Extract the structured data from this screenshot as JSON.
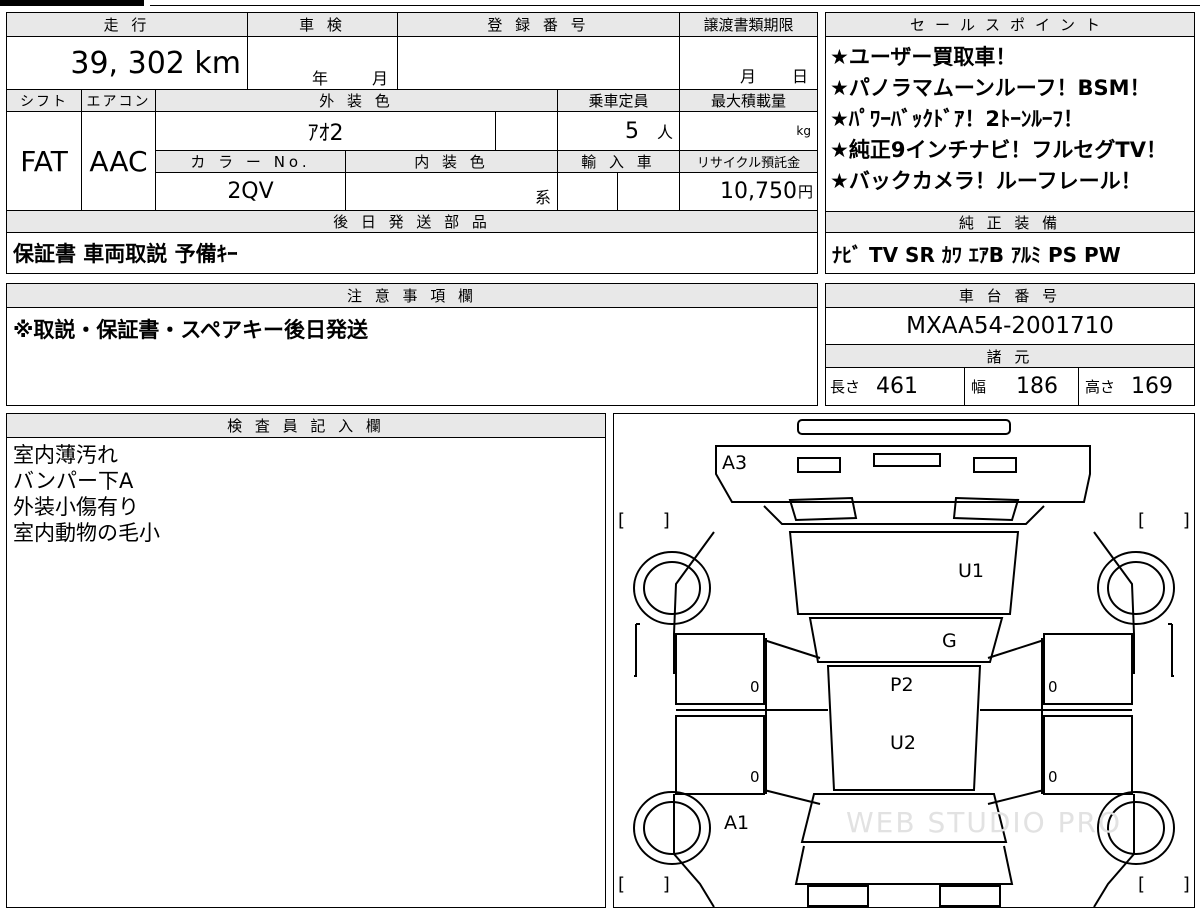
{
  "top_fields": {
    "mileage_label": "走 行",
    "mileage_value": "39, 302 km",
    "inspection_label": "車 検",
    "inspection_year_unit": "年",
    "inspection_month_unit": "月",
    "registration_label": "登 録 番 号",
    "registration_value": "",
    "transfer_deadline_label": "譲渡書類期限",
    "transfer_month_unit": "月",
    "transfer_day_unit": "日"
  },
  "spec_fields": {
    "shift_label": "シフト",
    "shift_value": "FAT",
    "aircon_label": "エアコン",
    "aircon_value": "AAC",
    "exterior_color_label": "外 装 色",
    "exterior_color_value": "ｱｵ2",
    "capacity_label": "乗車定員",
    "capacity_value": "5",
    "capacity_unit": "人",
    "max_load_label": "最大積載量",
    "max_load_unit": "kg",
    "color_no_label": "カ ラ ー No.",
    "color_no_value": "2QV",
    "interior_color_label": "内 装 色",
    "interior_color_suffix": "系",
    "import_label": "輸 入 車",
    "recycle_label": "リサイクル預託金",
    "recycle_value": "10,750",
    "recycle_unit": "円"
  },
  "later_parts": {
    "label": "後 日 発 送 部 品",
    "value": "保証書 車両取説 予備ｷｰ"
  },
  "notes": {
    "label": "注 意 事 項 欄",
    "value": "※取説・保証書・スペアキー後日発送"
  },
  "sales_points": {
    "label": "セールスポイント",
    "items": [
      "★ユーザー買取車！",
      "★パノラマムーンルーフ！BSM！",
      "★ﾊﾟﾜｰﾊﾞｯｸﾄﾞｱ！2ﾄｰﾝﾙｰﾌ！",
      "★純正9インチナビ！フルセグTV！",
      "★バックカメラ！ルーフレール！"
    ]
  },
  "factory_equipment": {
    "label": "純 正 装 備",
    "value": "ﾅﾋﾞ TV SR ｶﾜ ｴｱB ｱﾙﾐ PS PW"
  },
  "chassis": {
    "label": "車 台 番 号",
    "value": "MXAA54-2001710"
  },
  "dimensions": {
    "label": "諸 元",
    "length_label": "長さ",
    "length_value": "461",
    "width_label": "幅",
    "width_value": "186",
    "height_label": "高さ",
    "height_value": "169"
  },
  "inspector": {
    "label": "検 査 員 記 入 欄",
    "lines": [
      "室内薄汚れ",
      "バンパー下A",
      "外装小傷有り",
      "室内動物の毛小"
    ]
  },
  "diagram": {
    "marks": [
      "A3",
      "U1",
      "G",
      "P2",
      "U2",
      "A1"
    ],
    "door_left_front": "0",
    "door_left_rear": "0",
    "door_right_front": "0",
    "door_right_rear": "0",
    "bracket_left": "[ ]",
    "bracket_right": "[ ]",
    "watermark": "WEB STUDIO PRO"
  }
}
